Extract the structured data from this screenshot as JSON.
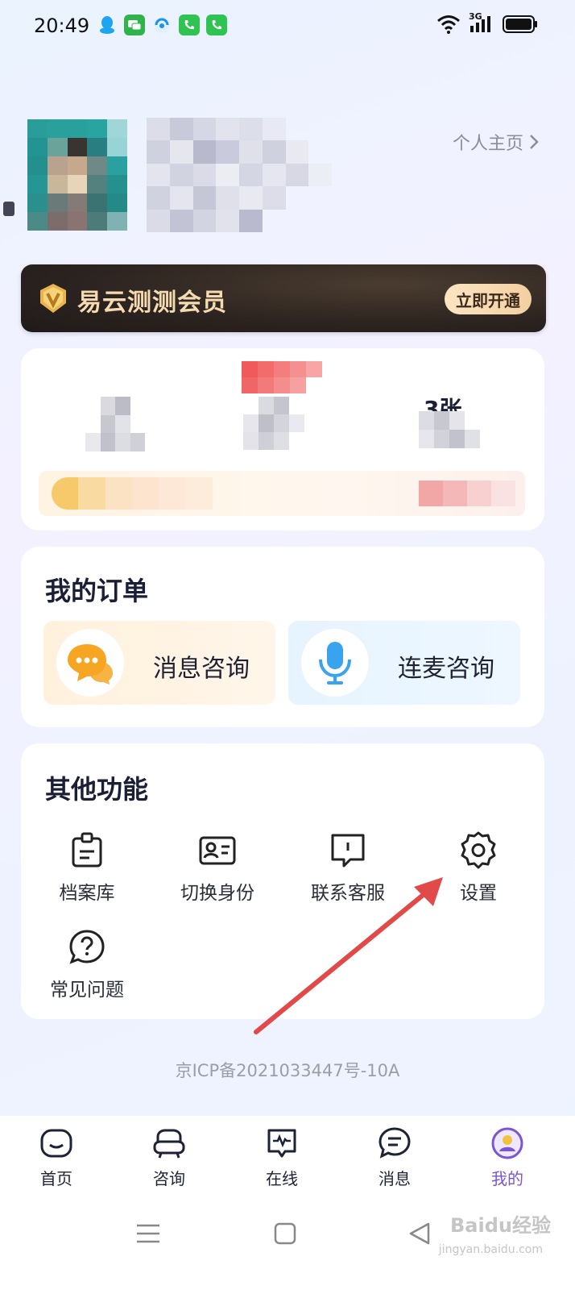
{
  "status_bar": {
    "time": "20:49",
    "notification_icons": [
      "qq-icon",
      "chat-icon",
      "browser-icon",
      "phone-icon",
      "phone-icon"
    ],
    "network_label": "3G"
  },
  "profile": {
    "homepage_link": "个人主页"
  },
  "member_banner": {
    "title": "易云测测会员",
    "cta": "立即开通"
  },
  "stats": {
    "right_value_visible": "3张"
  },
  "orders": {
    "title": "我的订单",
    "items": [
      {
        "label": "消息咨询",
        "icon": "chat-bubbles-icon"
      },
      {
        "label": "连麦咨询",
        "icon": "microphone-icon"
      }
    ]
  },
  "other_functions": {
    "title": "其他功能",
    "items": [
      {
        "label": "档案库",
        "icon": "archive-icon"
      },
      {
        "label": "切换身份",
        "icon": "id-card-icon"
      },
      {
        "label": "联系客服",
        "icon": "customer-service-icon"
      },
      {
        "label": "设置",
        "icon": "gear-icon"
      },
      {
        "label": "常见问题",
        "icon": "question-icon"
      }
    ]
  },
  "icp": "京ICP备2021033447号-10A",
  "tabbar": {
    "active_color": "#7a55d6",
    "items": [
      {
        "label": "首页",
        "icon": "home-icon"
      },
      {
        "label": "咨询",
        "icon": "sofa-icon"
      },
      {
        "label": "在线",
        "icon": "pulse-icon"
      },
      {
        "label": "消息",
        "icon": "message-icon"
      },
      {
        "label": "我的",
        "icon": "profile-icon",
        "active": true
      }
    ]
  },
  "watermark": {
    "brand": "Baidu经验",
    "url": "jingyan.baidu.com"
  }
}
